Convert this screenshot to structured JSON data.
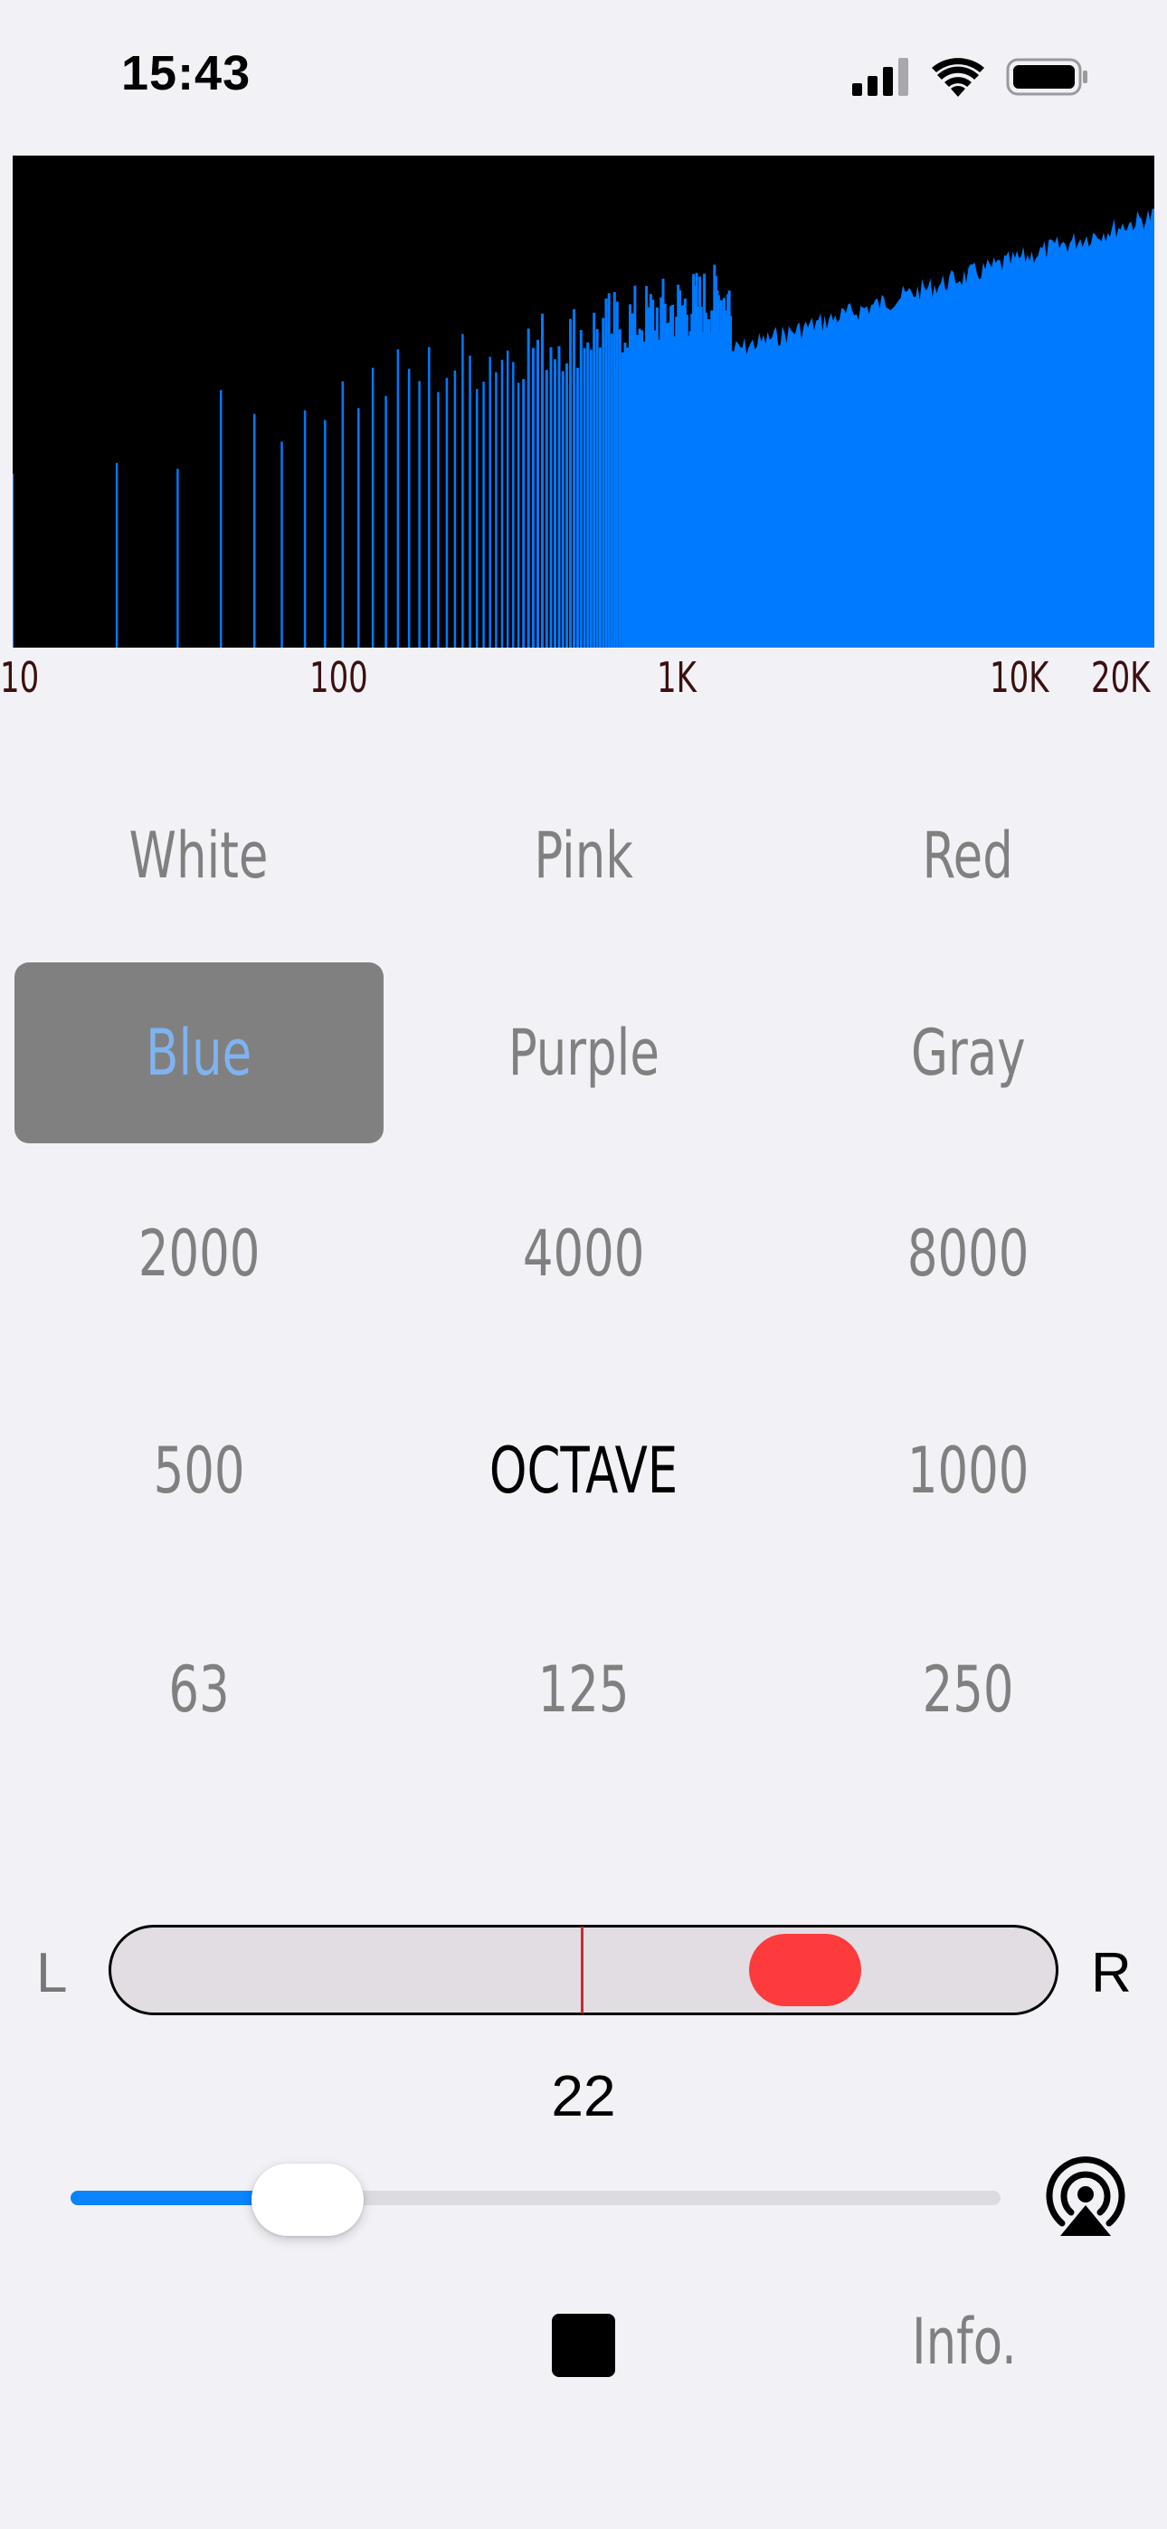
{
  "status_bar": {
    "time": "15:43"
  },
  "spectrum": {
    "color": "#007aff",
    "background": "#000000",
    "axis_labels": [
      "10",
      "100",
      "1K",
      "10K",
      "20K"
    ]
  },
  "noise_colors": {
    "items": [
      "White",
      "Pink",
      "Red",
      "Blue",
      "Purple",
      "Gray"
    ],
    "selected": "Blue"
  },
  "bands": {
    "row1": [
      "2000",
      "4000",
      "8000"
    ],
    "row2": [
      "500",
      "OCTAVE",
      "1000"
    ],
    "row3": [
      "63",
      "125",
      "250"
    ]
  },
  "balance": {
    "left_label": "L",
    "right_label": "R",
    "accent": "#fd3a3c"
  },
  "volume": {
    "value": "22",
    "level": 0.22,
    "accent": "#0a84ff"
  },
  "controls": {
    "info_label": "Info."
  }
}
